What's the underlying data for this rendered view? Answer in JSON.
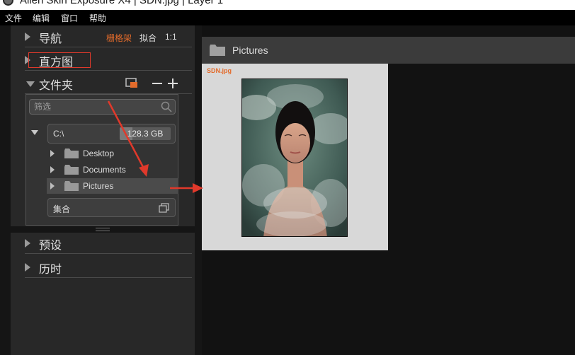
{
  "window": {
    "title": "Alien Skin Exposure X4 | SDN.jpg | Layer 1"
  },
  "menu": [
    "文件",
    "编辑",
    "窗口",
    "帮助"
  ],
  "sections": {
    "navigation": {
      "label": "导航",
      "options": [
        "栅格架",
        "拟合",
        "1:1"
      ],
      "active_option": "栅格架"
    },
    "histogram": {
      "label": "直方图"
    },
    "folders": {
      "label": "文件夹",
      "filter_placeholder": "筛选",
      "drive": {
        "label": "C:\\",
        "capacity": "128.3 GB",
        "used_fraction": 0.25
      },
      "items": [
        {
          "label": "Desktop",
          "selected": false
        },
        {
          "label": "Documents",
          "selected": false
        },
        {
          "label": "Pictures",
          "selected": true
        }
      ],
      "collections_label": "集合",
      "add_label": "+",
      "remove_label": "−"
    },
    "presets": {
      "label": "预设"
    },
    "history": {
      "label": "历时"
    }
  },
  "browser": {
    "folder_title": "Pictures",
    "thumbnails": [
      {
        "filename": "SDN.jpg"
      }
    ]
  },
  "colors": {
    "accent_orange": "#e36b2b",
    "annotation_red": "#e0392b",
    "panel_bg": "#282828",
    "workspace_bg": "#121212"
  }
}
